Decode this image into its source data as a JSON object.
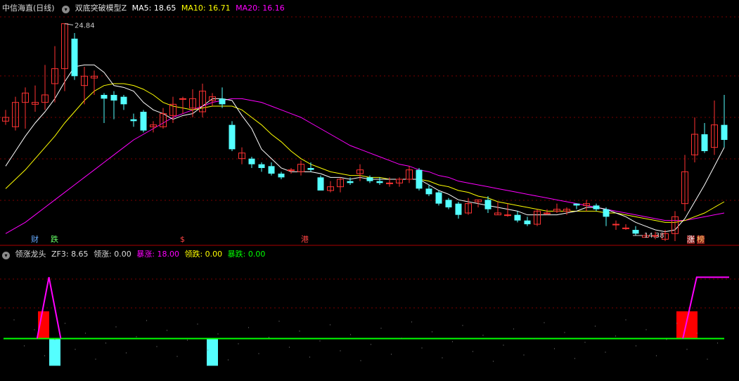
{
  "header": {
    "stock": "中信海直(日线)",
    "indicator": "双底突破模型Z",
    "ma5_label": "MA5: 18.65",
    "ma10_label": "MA10: 16.71",
    "ma20_label": "MA20: 16.16"
  },
  "sub_header": {
    "indicator": "领涨龙头",
    "zf3": "ZF3: 8.65",
    "lz": "领涨: 0.00",
    "bz": "暴涨: 18.00",
    "ld": "领跌: 0.00",
    "bd": "暴跌: 0.00"
  },
  "colors": {
    "up": "#ff3232",
    "down": "#54ffff",
    "ma5": "#ffffff",
    "ma10": "#ffff00",
    "ma20": "#ff00ff",
    "zero": "#00ff00",
    "grid": "#7a0000"
  },
  "markers": {
    "cai": "财",
    "die": "跌",
    "s": "$",
    "gang": "港",
    "zhang": "涨",
    "bang": "榜"
  },
  "chart_data": {
    "type": "candlestick",
    "ylim": [
      13.5,
      25.5
    ],
    "high_label": "24.84",
    "low_label": "14.38",
    "candles": [
      [
        19.6,
        19.8,
        19.4,
        20.2
      ],
      [
        19.3,
        20.6,
        19.1,
        20.9
      ],
      [
        20.6,
        21.1,
        19.2,
        21.4
      ],
      [
        20.5,
        20.6,
        20.1,
        21.5
      ],
      [
        20.6,
        21.0,
        20.2,
        22.6
      ],
      [
        21.6,
        22.4,
        20.6,
        23.6
      ],
      [
        22.4,
        24.8,
        21.2,
        24.8
      ],
      [
        24.0,
        22.0,
        21.8,
        24.3
      ],
      [
        21.5,
        22.0,
        20.5,
        22.5
      ],
      [
        21.9,
        22.0,
        21.0,
        22.3
      ],
      [
        21.0,
        20.8,
        19.5,
        21.1
      ],
      [
        21.0,
        20.7,
        19.7,
        21.2
      ],
      [
        20.9,
        20.5,
        20.2,
        21.0
      ],
      [
        19.7,
        19.6,
        19.3,
        20.0
      ],
      [
        20.1,
        19.1,
        19.0,
        20.2
      ],
      [
        19.3,
        19.4,
        19.0,
        19.6
      ],
      [
        19.3,
        20.0,
        19.2,
        20.3
      ],
      [
        19.9,
        20.5,
        19.5,
        20.9
      ],
      [
        20.8,
        20.8,
        20.0,
        20.9
      ],
      [
        20.3,
        20.8,
        19.8,
        21.3
      ],
      [
        20.1,
        21.2,
        19.8,
        21.6
      ],
      [
        20.7,
        20.9,
        20.4,
        21.1
      ],
      [
        20.8,
        20.5,
        20.3,
        21.4
      ],
      [
        19.4,
        18.1,
        18.0,
        19.6
      ],
      [
        17.6,
        17.9,
        17.3,
        18.2
      ],
      [
        17.6,
        17.3,
        17.1,
        17.7
      ],
      [
        17.3,
        17.1,
        16.9,
        17.4
      ],
      [
        17.2,
        16.8,
        16.7,
        17.4
      ],
      [
        16.8,
        16.6,
        16.5,
        16.9
      ],
      [
        17.0,
        17.0,
        16.8,
        17.1
      ],
      [
        16.9,
        17.3,
        16.7,
        17.5
      ],
      [
        17.1,
        17.0,
        16.9,
        17.4
      ],
      [
        16.6,
        15.9,
        15.9,
        16.7
      ],
      [
        15.9,
        16.1,
        15.8,
        16.4
      ],
      [
        16.1,
        16.5,
        15.8,
        16.6
      ],
      [
        16.4,
        16.3,
        16.2,
        16.6
      ],
      [
        16.8,
        17.0,
        16.4,
        17.3
      ],
      [
        16.6,
        16.4,
        16.3,
        16.7
      ],
      [
        16.4,
        16.3,
        16.2,
        16.6
      ],
      [
        16.3,
        16.3,
        16.1,
        16.6
      ],
      [
        16.3,
        16.5,
        16.1,
        16.6
      ],
      [
        16.5,
        17.0,
        16.3,
        17.2
      ],
      [
        17.0,
        16.0,
        15.9,
        17.1
      ],
      [
        16.0,
        15.7,
        15.6,
        16.2
      ],
      [
        15.8,
        15.2,
        15.1,
        15.9
      ],
      [
        15.4,
        15.0,
        14.9,
        15.5
      ],
      [
        15.2,
        14.6,
        14.4,
        15.3
      ],
      [
        14.7,
        15.2,
        14.6,
        15.5
      ],
      [
        15.3,
        15.4,
        15.0,
        15.4
      ],
      [
        15.4,
        14.9,
        14.7,
        15.6
      ],
      [
        14.6,
        14.7,
        14.6,
        15.3
      ],
      [
        14.6,
        14.6,
        14.5,
        15.2
      ],
      [
        14.6,
        14.3,
        14.2,
        14.8
      ],
      [
        14.3,
        14.1,
        14.0,
        14.5
      ],
      [
        14.1,
        14.8,
        14.0,
        14.9
      ],
      [
        14.7,
        14.7,
        14.6,
        14.9
      ],
      [
        14.8,
        14.9,
        14.7,
        15.2
      ],
      [
        14.8,
        14.9,
        14.6,
        15.0
      ],
      [
        15.2,
        15.1,
        14.9,
        15.2
      ],
      [
        15.1,
        15.2,
        14.8,
        15.4
      ],
      [
        15.1,
        14.9,
        14.8,
        15.2
      ],
      [
        14.9,
        14.5,
        14.0,
        15.0
      ],
      [
        14.1,
        14.1,
        13.8,
        14.3
      ],
      [
        13.9,
        13.9,
        13.8,
        14.1
      ],
      [
        13.8,
        13.6,
        13.5,
        14.0
      ],
      [
        13.4,
        13.5,
        13.4,
        13.6
      ],
      [
        13.5,
        13.5,
        13.3,
        13.7
      ],
      [
        13.3,
        13.6,
        13.2,
        13.8
      ],
      [
        13.6,
        14.5,
        13.2,
        14.8
      ],
      [
        15.2,
        16.9,
        14.8,
        17.8
      ],
      [
        17.8,
        18.9,
        17.4,
        19.8
      ],
      [
        18.9,
        18.0,
        17.9,
        19.5
      ],
      [
        18.2,
        19.4,
        17.8,
        20.7
      ],
      [
        19.4,
        18.6,
        18.2,
        21.0
      ]
    ],
    "ma5": [
      17.2,
      18.0,
      18.8,
      19.5,
      20.1,
      20.8,
      21.7,
      22.5,
      22.6,
      22.6,
      22.2,
      21.5,
      21.4,
      21.2,
      20.6,
      20.2,
      20.0,
      19.7,
      19.9,
      20.0,
      20.4,
      20.8,
      20.8,
      20.7,
      19.9,
      19.2,
      18.1,
      17.6,
      17.1,
      16.9,
      16.9,
      16.9,
      16.8,
      16.6,
      16.6,
      16.5,
      16.6,
      16.5,
      16.5,
      16.5,
      16.5,
      16.5,
      16.5,
      16.2,
      15.9,
      15.7,
      15.4,
      15.3,
      15.2,
      15.1,
      15.0,
      14.9,
      14.8,
      14.6,
      14.6,
      14.6,
      14.6,
      14.7,
      14.8,
      15.0,
      15.0,
      14.9,
      14.7,
      14.5,
      14.2,
      14.0,
      13.8,
      13.7,
      13.8,
      14.4,
      15.3,
      16.2,
      17.2,
      18.2
    ],
    "ma10": [
      16.0,
      16.5,
      17.0,
      17.6,
      18.2,
      18.8,
      19.5,
      20.1,
      20.7,
      21.2,
      21.5,
      21.6,
      21.6,
      21.5,
      21.3,
      21.0,
      20.6,
      20.4,
      20.3,
      20.2,
      20.3,
      20.4,
      20.4,
      20.4,
      20.2,
      19.8,
      19.4,
      18.9,
      18.5,
      18.0,
      17.6,
      17.3,
      17.1,
      16.9,
      16.8,
      16.7,
      16.7,
      16.6,
      16.6,
      16.5,
      16.5,
      16.5,
      16.5,
      16.4,
      16.2,
      16.1,
      15.9,
      15.8,
      15.6,
      15.5,
      15.3,
      15.2,
      15.1,
      15.0,
      14.9,
      14.8,
      14.8,
      14.8,
      14.8,
      14.8,
      14.8,
      14.7,
      14.7,
      14.6,
      14.5,
      14.4,
      14.3,
      14.2,
      14.2,
      14.3,
      14.5,
      14.7,
      15.0,
      15.3
    ],
    "ma20": [
      13.6,
      13.9,
      14.2,
      14.6,
      15.0,
      15.4,
      15.8,
      16.2,
      16.6,
      17.0,
      17.4,
      17.8,
      18.2,
      18.6,
      18.9,
      19.2,
      19.5,
      19.8,
      20.0,
      20.2,
      20.4,
      20.6,
      20.7,
      20.8,
      20.8,
      20.7,
      20.6,
      20.4,
      20.2,
      20.0,
      19.8,
      19.5,
      19.2,
      18.9,
      18.6,
      18.3,
      18.1,
      17.9,
      17.7,
      17.5,
      17.3,
      17.2,
      17.0,
      16.9,
      16.7,
      16.6,
      16.4,
      16.3,
      16.2,
      16.1,
      16.0,
      15.9,
      15.8,
      15.7,
      15.6,
      15.5,
      15.4,
      15.3,
      15.2,
      15.1,
      15.0,
      14.9,
      14.8,
      14.7,
      14.6,
      14.5,
      14.4,
      14.3,
      14.3,
      14.3,
      14.4,
      14.5,
      14.6,
      14.7
    ],
    "sub": {
      "ylim": [
        -10,
        22
      ],
      "red_bars": [
        {
          "i": 4,
          "v": 8
        },
        {
          "i": 68,
          "v": 8
        }
      ],
      "cyan_bars": [
        {
          "i": 5,
          "v": -8
        },
        {
          "i": 21,
          "v": -8
        }
      ],
      "magenta_spikes": [
        {
          "points": [
            [
              3.2,
              0
            ],
            [
              4.4,
              18
            ],
            [
              5.6,
              0
            ]
          ]
        },
        {
          "points": [
            [
              68.8,
              0
            ],
            [
              70.2,
              18
            ],
            [
              73.5,
              18
            ]
          ]
        }
      ]
    }
  }
}
